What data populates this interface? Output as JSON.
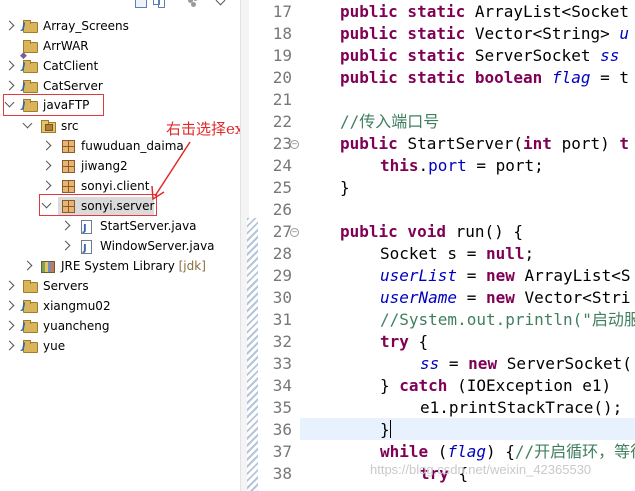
{
  "explorer": {
    "items": [
      {
        "label": "Array_Screens",
        "type": "project",
        "state": "collapsed"
      },
      {
        "label": "ArrWAR",
        "type": "project",
        "state": "none"
      },
      {
        "label": "CatClient",
        "type": "project",
        "state": "collapsed"
      },
      {
        "label": "CatServer",
        "type": "project",
        "state": "collapsed"
      },
      {
        "label": "javaFTP",
        "type": "project",
        "state": "expanded"
      },
      {
        "label": "src",
        "type": "srcfolder",
        "state": "expanded"
      },
      {
        "label": "fuwuduan_daima",
        "type": "package",
        "state": "collapsed"
      },
      {
        "label": "jiwang2",
        "type": "package",
        "state": "collapsed"
      },
      {
        "label": "sonyi.client",
        "type": "package",
        "state": "collapsed"
      },
      {
        "label": "sonyi.server",
        "type": "package",
        "state": "expanded"
      },
      {
        "label": "StartServer.java",
        "type": "java",
        "state": "collapsed"
      },
      {
        "label": "WindowServer.java",
        "type": "java",
        "state": "collapsed"
      },
      {
        "label": "JRE System Library",
        "decoration": "[jdk]",
        "type": "library",
        "state": "collapsed"
      },
      {
        "label": "Servers",
        "type": "project",
        "state": "collapsed"
      },
      {
        "label": "xiangmu02",
        "type": "project",
        "state": "collapsed"
      },
      {
        "label": "yuancheng",
        "type": "project",
        "state": "collapsed"
      },
      {
        "label": "yue",
        "type": "project",
        "state": "collapsed"
      }
    ]
  },
  "annotation": {
    "text": "右击选择export",
    "color": "#e02a2a"
  },
  "editor": {
    "line_numbers": [
      "17",
      "18",
      "19",
      "20",
      "21",
      "22",
      "23",
      "24",
      "25",
      "26",
      "27",
      "28",
      "29",
      "30",
      "31",
      "32",
      "33",
      "34",
      "35",
      "36",
      "37",
      "38"
    ],
    "code": {
      "l17_kw": "public static ",
      "l17_rest": "ArrayList<Socket",
      "l18_kw": "public static ",
      "l18_rest": "Vector<String> ",
      "l18_tail": "u",
      "l19_kw": "public static ",
      "l19_rest": "ServerSocket ",
      "l19_tail": "ss",
      "l20_kw": "public static boolean ",
      "l20_fld": "flag",
      "l20_tail": " = t",
      "l22_cm": "//传入端口号",
      "l23_kw": "public ",
      "l23_a": "StartServer(",
      "l23_kw2": "int ",
      "l23_b": "port) ",
      "l23_c": "t",
      "l24_kw": "this",
      "l24_a": ".",
      "l24_fld": "port",
      "l24_b": " = port;",
      "l25": "}",
      "l27_kw": "public void ",
      "l27_a": "run() {",
      "l28_a": "Socket s = ",
      "l28_kw": "null",
      "l28_b": ";",
      "l29_fld": "userList",
      "l29_a": " = ",
      "l29_kw": "new ",
      "l29_b": "ArrayList<S",
      "l30_fld": "userName",
      "l30_a": " = ",
      "l30_kw": "new ",
      "l30_b": "Vector<Stri",
      "l31_cm": "//System.out.println(\"启动服",
      "l32_kw": "try ",
      "l32_a": "{",
      "l33_fld": "ss",
      "l33_a": " = ",
      "l33_kw": "new ",
      "l33_b": "ServerSocket(",
      "l34_a": "} ",
      "l34_kw": "catch ",
      "l34_b": "(IOException e1) ",
      "l35_a": "e1.printStackTrace();",
      "l36_a": "}",
      "l37_kw": "while ",
      "l37_a": "(",
      "l37_fld": "flag",
      "l37_b": ") {",
      "l37_cm": "//开启循环，等待",
      "l38_kw": "try ",
      "l38_a": "{"
    }
  },
  "watermark": "https://blog.csdn.net/weixin_42365530",
  "colors": {
    "keyword": "#7f0055",
    "field": "#0000c0",
    "comment": "#3f7f5f",
    "highlight_box": "#e0393e"
  }
}
